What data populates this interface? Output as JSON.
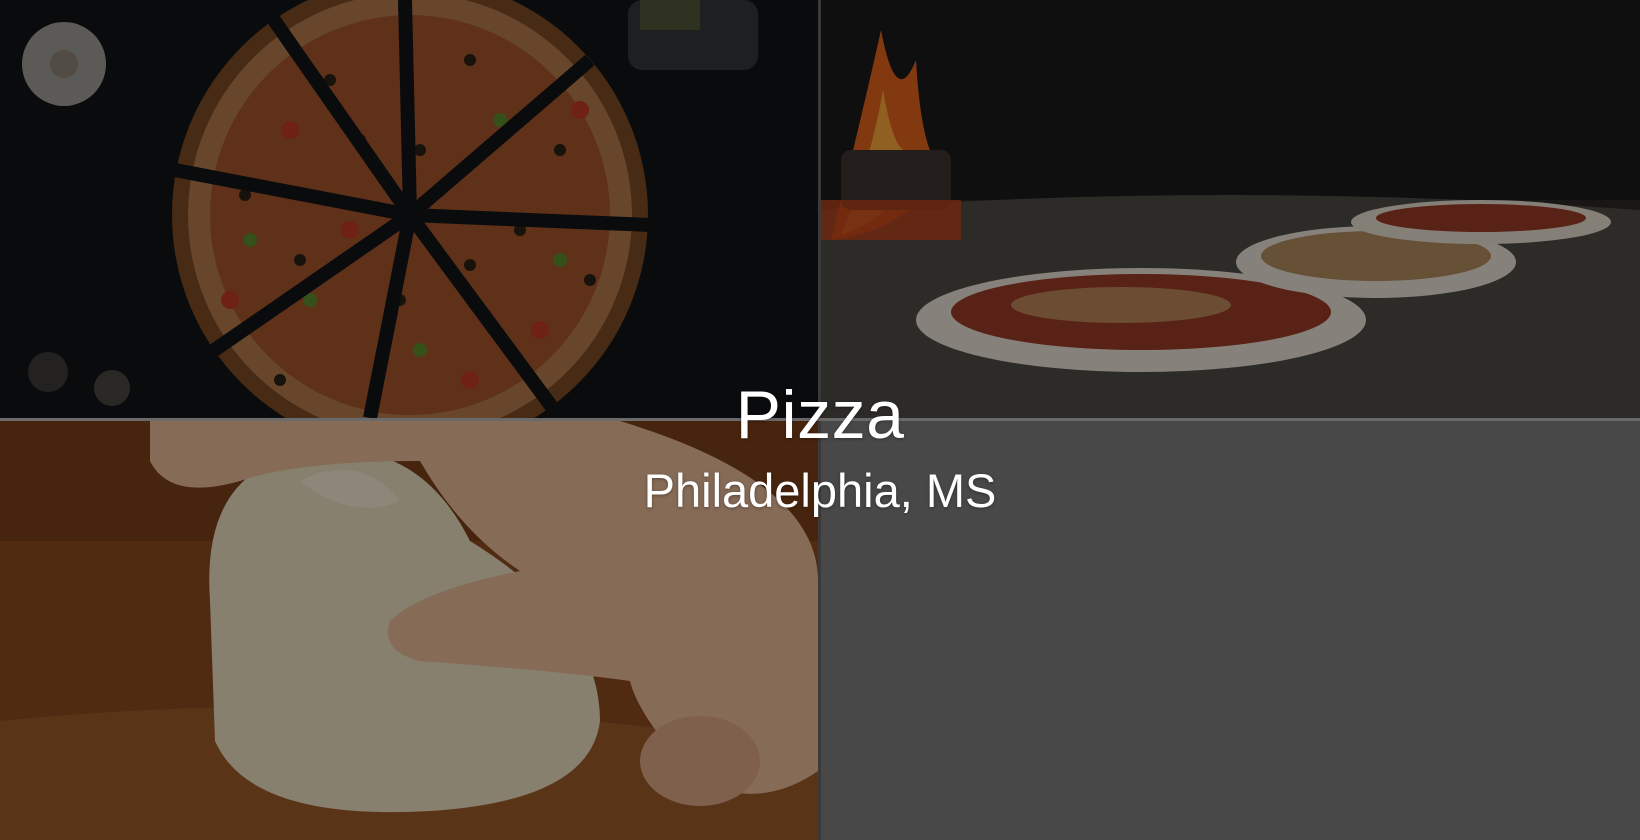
{
  "hero": {
    "title": "Pizza",
    "subtitle": "Philadelphia, MS"
  },
  "images": [
    {
      "name": "sliced-pizza-photo",
      "description_icon": "pizza-icon"
    },
    {
      "name": "pizza-oven-photo",
      "description_icon": "fire-icon"
    },
    {
      "name": "dough-kneading-photo",
      "description_icon": "dough-icon"
    }
  ],
  "colors": {
    "background": "#484848",
    "text": "#ffffff"
  }
}
